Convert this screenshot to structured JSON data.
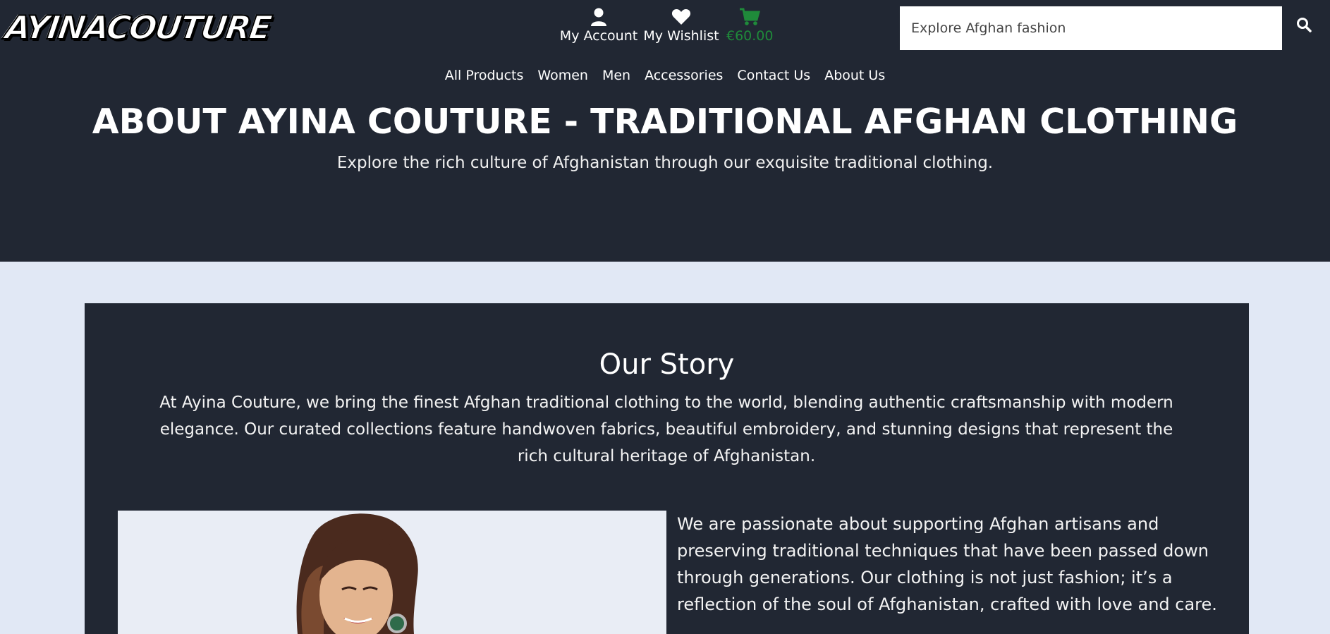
{
  "brand": {
    "logo_text": "AYINACOUTURE"
  },
  "account_links": {
    "account": {
      "label": "My Account",
      "icon": "user-icon"
    },
    "wishlist": {
      "label": "My Wishlist",
      "icon": "heart-icon"
    },
    "cart": {
      "label": "€60.00",
      "icon": "cart-icon",
      "color": "#1f8a3a"
    }
  },
  "search": {
    "placeholder": "Explore Afghan fashion",
    "icon": "search-icon"
  },
  "nav": [
    {
      "label": "All Products"
    },
    {
      "label": "Women"
    },
    {
      "label": "Men"
    },
    {
      "label": "Accessories"
    },
    {
      "label": "Contact Us"
    },
    {
      "label": "About Us"
    }
  ],
  "hero": {
    "title": "ABOUT AYINA COUTURE - TRADITIONAL AFGHAN CLOTHING",
    "subtitle": "Explore the rich culture of Afghanistan through our exquisite traditional clothing."
  },
  "story": {
    "title": "Our Story",
    "intro": "At Ayina Couture, we bring the finest Afghan traditional clothing to the world, blending authentic craftsmanship with modern elegance. Our curated collections feature handwoven fabrics, beautiful embroidery, and stunning designs that represent the rich cultural heritage of Afghanistan.",
    "paragraph": "We are passionate about supporting Afghan artisans and preserving traditional techniques that have been passed down through generations. Our clothing is not just fashion; it’s a reflection of the soul of Afghanistan, crafted with love and care."
  },
  "colors": {
    "header_bg": "#212733",
    "page_bg": "#e1e8f5",
    "accent_green": "#1f8a3a"
  }
}
